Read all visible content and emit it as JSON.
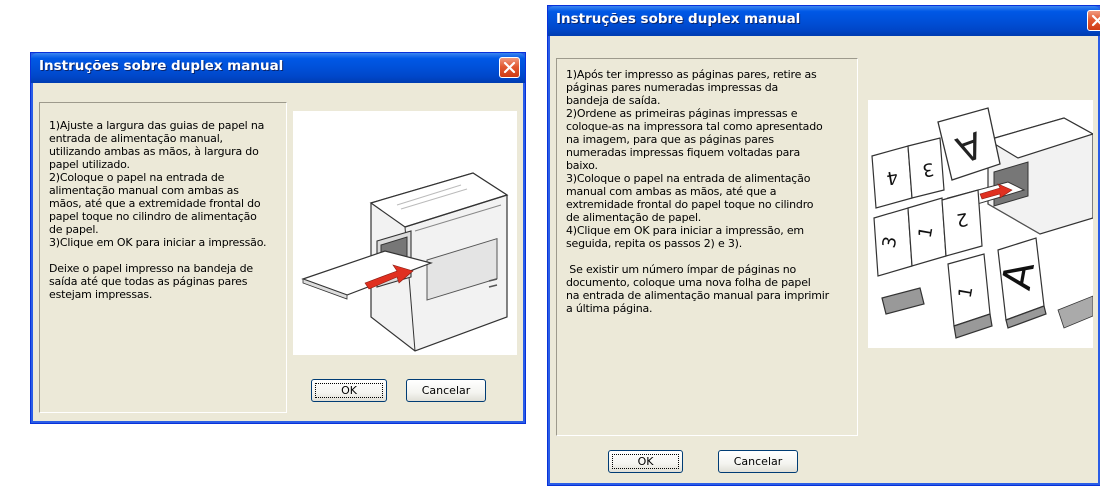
{
  "dialogs": [
    {
      "title": "Instruções sobre duplex manual",
      "instructions": "1)Ajuste a largura das guias de papel na\nentrada de alimentação manual,\nutilizando ambas as mãos, à largura do\npapel utilizado.\n2)Coloque o papel na entrada de\nalimentação manual com ambas as\nmãos, até que a extremidade frontal do\npapel toque no cilindro de alimentação\nde papel.\n3)Clique em OK para iniciar a impressão.\n\nDeixe o papel impresso na bandeja de\nsaída até que todas as páginas pares\nestejam impressas.",
      "ok_label": "OK",
      "cancel_label": "Cancelar",
      "illustration_icon": "printer-manual-feed-icon"
    },
    {
      "title": "Instruções sobre duplex manual",
      "instructions": "1)Após ter impresso as páginas pares, retire as\npáginas pares numeradas impressas da\nbandeja de saída.\n2)Ordene as primeiras páginas impressas e\ncoloque-as na impressora tal como apresentado\nna imagem, para que as páginas pares\nnumeradas impressas fiquem voltadas para\nbaixo.\n3)Coloque o papel na entrada de alimentação\nmanual com ambas as mãos, até que a\nextremidade frontal do papel toque no cilindro\nde alimentação de papel.\n4)Clique em OK para iniciar a impressão, em\nseguida, repita os passos 2) e 3).\n\n Se existir um número ímpar de páginas no\ndocumento, coloque uma nova folha de papel\nna entrada de alimentação manual para imprimir\na última página.",
      "ok_label": "OK",
      "cancel_label": "Cancelar",
      "illustration_icon": "printer-page-order-icon"
    }
  ],
  "colors": {
    "titlebar": "#0054e3",
    "dialog_bg": "#ece9d8",
    "close_button": "#e25a32",
    "paper_arrow": "#e03020"
  }
}
